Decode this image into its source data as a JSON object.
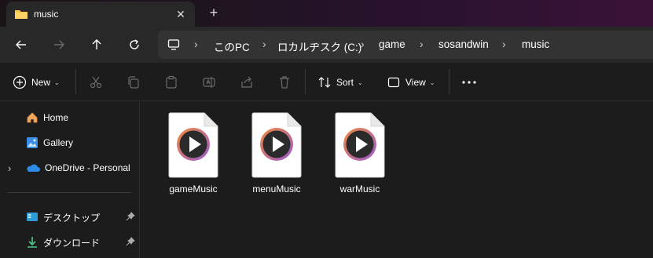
{
  "tab": {
    "title": "music",
    "close_label": "✕",
    "new_label": "+"
  },
  "breadcrumb": [
    "このPC",
    "ロカルヂスク (C:)",
    "game",
    "sosandwin",
    "music"
  ],
  "commands": {
    "new_label": "New",
    "sort_label": "Sort",
    "view_label": "View"
  },
  "sidebar": {
    "items": [
      {
        "label": "Home",
        "icon": "home-icon"
      },
      {
        "label": "Gallery",
        "icon": "gallery-icon"
      },
      {
        "label": "OneDrive - Personal",
        "icon": "onedrive-icon"
      },
      {
        "label": "デスクトップ",
        "icon": "desktop-icon"
      },
      {
        "label": "ダウンロード",
        "icon": "download-icon"
      }
    ]
  },
  "files": [
    {
      "name": "gameMusic",
      "icon": "media-file-icon"
    },
    {
      "name": "menuMusic",
      "icon": "media-file-icon"
    },
    {
      "name": "warMusic",
      "icon": "media-file-icon"
    }
  ],
  "colors": {
    "accent_blue": "#4cc2ff",
    "folder_yellow": "#f5c242",
    "play_ring_orange": "#f08a3c",
    "play_ring_purple": "#9b59d0"
  }
}
